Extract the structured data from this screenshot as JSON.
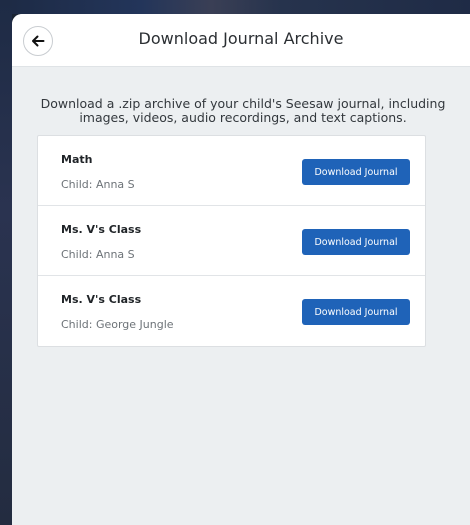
{
  "header": {
    "title": "Download Journal Archive",
    "back_icon": "arrow-left-icon"
  },
  "description": "Download a .zip archive of your child's Seesaw journal, including images, videos, audio recordings, and text captions.",
  "journals": [
    {
      "title": "Math",
      "child": "Child: Anna S",
      "button_label": "Download Journal"
    },
    {
      "title": "Ms. V's Class",
      "child": "Child: Anna S",
      "button_label": "Download Journal"
    },
    {
      "title": "Ms. V's Class",
      "child": "Child: George Jungle",
      "button_label": "Download Journal"
    }
  ],
  "colors": {
    "accent": "#1f63b8",
    "background": "#eceff1"
  }
}
